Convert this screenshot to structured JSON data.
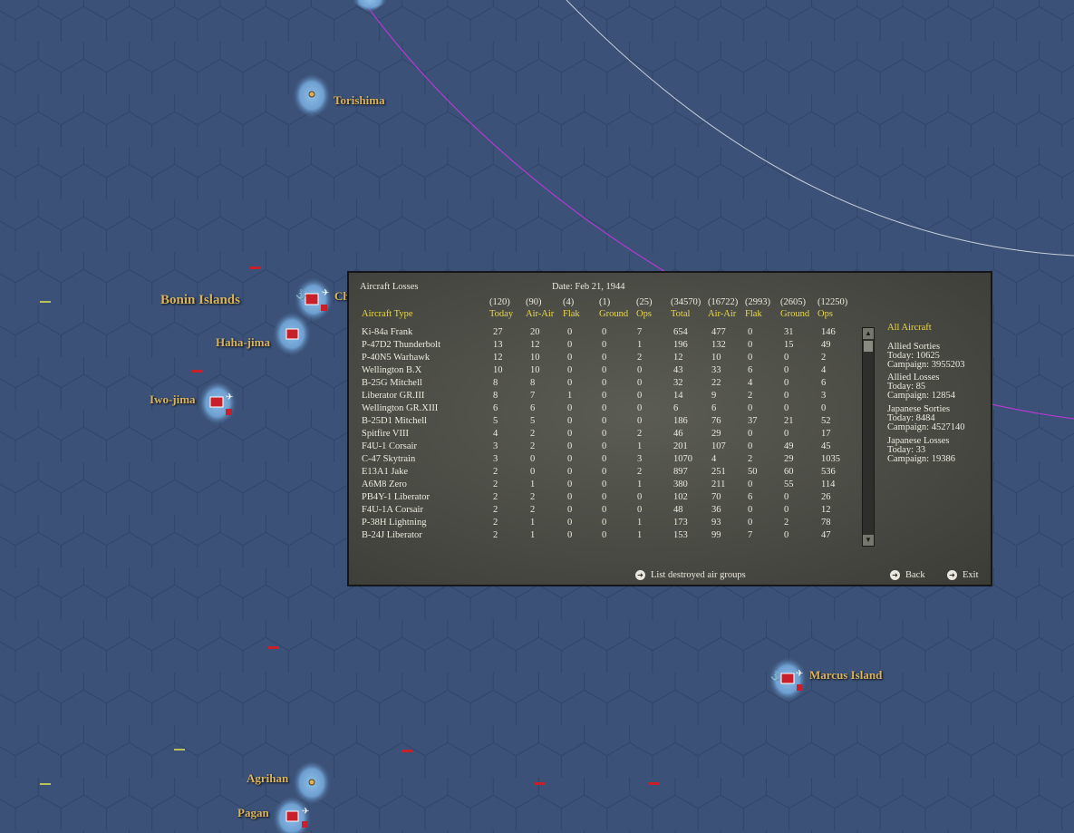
{
  "map": {
    "places": [
      {
        "id": "torishima",
        "label": "Torishima"
      },
      {
        "id": "bonin",
        "label": "Bonin Islands"
      },
      {
        "id": "chichi",
        "label": "Ch"
      },
      {
        "id": "haha",
        "label": "Haha-jima"
      },
      {
        "id": "iwo",
        "label": "Iwo-jima"
      },
      {
        "id": "marcus",
        "label": "Marcus Island"
      },
      {
        "id": "agrihan",
        "label": "Agrihan"
      },
      {
        "id": "pagan",
        "label": "Pagan"
      }
    ]
  },
  "panel": {
    "title": "Aircraft Losses",
    "date": "Date: Feb 21, 1944",
    "headers": [
      {
        "total": "",
        "label": "Aircraft Type"
      },
      {
        "total": "(120)",
        "label": "Today"
      },
      {
        "total": "(90)",
        "label": "Air-Air"
      },
      {
        "total": "(4)",
        "label": "Flak"
      },
      {
        "total": "(1)",
        "label": "Ground"
      },
      {
        "total": "(25)",
        "label": "Ops"
      },
      {
        "total": "(34570)",
        "label": "Total"
      },
      {
        "total": "(16722)",
        "label": "Air-Air"
      },
      {
        "total": "(2993)",
        "label": "Flak"
      },
      {
        "total": "(2605)",
        "label": "Ground"
      },
      {
        "total": "(12250)",
        "label": "Ops"
      }
    ],
    "rows": [
      [
        "Ki-84a Frank",
        "27",
        "20",
        "0",
        "0",
        "7",
        "654",
        "477",
        "0",
        "31",
        "146"
      ],
      [
        "P-47D2 Thunderbolt",
        "13",
        "12",
        "0",
        "0",
        "1",
        "196",
        "132",
        "0",
        "15",
        "49"
      ],
      [
        "P-40N5 Warhawk",
        "12",
        "10",
        "0",
        "0",
        "2",
        "12",
        "10",
        "0",
        "0",
        "2"
      ],
      [
        "Wellington B.X",
        "10",
        "10",
        "0",
        "0",
        "0",
        "43",
        "33",
        "6",
        "0",
        "4"
      ],
      [
        "B-25G Mitchell",
        "8",
        "8",
        "0",
        "0",
        "0",
        "32",
        "22",
        "4",
        "0",
        "6"
      ],
      [
        "Liberator GR.III",
        "8",
        "7",
        "1",
        "0",
        "0",
        "14",
        "9",
        "2",
        "0",
        "3"
      ],
      [
        "Wellington GR.XIII",
        "6",
        "6",
        "0",
        "0",
        "0",
        "6",
        "6",
        "0",
        "0",
        "0"
      ],
      [
        "B-25D1 Mitchell",
        "5",
        "5",
        "0",
        "0",
        "0",
        "186",
        "76",
        "37",
        "21",
        "52"
      ],
      [
        "Spitfire VIII",
        "4",
        "2",
        "0",
        "0",
        "2",
        "46",
        "29",
        "0",
        "0",
        "17"
      ],
      [
        "F4U-1 Corsair",
        "3",
        "2",
        "0",
        "0",
        "1",
        "201",
        "107",
        "0",
        "49",
        "45"
      ],
      [
        "C-47 Skytrain",
        "3",
        "0",
        "0",
        "0",
        "3",
        "1070",
        "4",
        "2",
        "29",
        "1035"
      ],
      [
        "E13A1 Jake",
        "2",
        "0",
        "0",
        "0",
        "2",
        "897",
        "251",
        "50",
        "60",
        "536"
      ],
      [
        "A6M8 Zero",
        "2",
        "1",
        "0",
        "0",
        "1",
        "380",
        "211",
        "0",
        "55",
        "114"
      ],
      [
        "PB4Y-1 Liberator",
        "2",
        "2",
        "0",
        "0",
        "0",
        "102",
        "70",
        "6",
        "0",
        "26"
      ],
      [
        "F4U-1A Corsair",
        "2",
        "2",
        "0",
        "0",
        "0",
        "48",
        "36",
        "0",
        "0",
        "12"
      ],
      [
        "P-38H Lightning",
        "2",
        "1",
        "0",
        "0",
        "1",
        "173",
        "93",
        "0",
        "2",
        "78"
      ],
      [
        "B-24J Liberator",
        "2",
        "1",
        "0",
        "0",
        "1",
        "153",
        "99",
        "7",
        "0",
        "47"
      ]
    ],
    "side": {
      "filter": "All Aircraft",
      "blocks": [
        {
          "title": "Allied Sorties",
          "today": "Today:   10625",
          "campaign": "Campaign: 3955203"
        },
        {
          "title": "Allied Losses",
          "today": "Today:   85",
          "campaign": "Campaign: 12854"
        },
        {
          "title": "Japanese Sorties",
          "today": "Today:   8484",
          "campaign": "Campaign: 4527140"
        },
        {
          "title": "Japanese Losses",
          "today": "Today:   33",
          "campaign": "Campaign: 19386"
        }
      ]
    },
    "buttons": {
      "list": "List destroyed air groups",
      "back": "Back",
      "exit": "Exit"
    }
  }
}
